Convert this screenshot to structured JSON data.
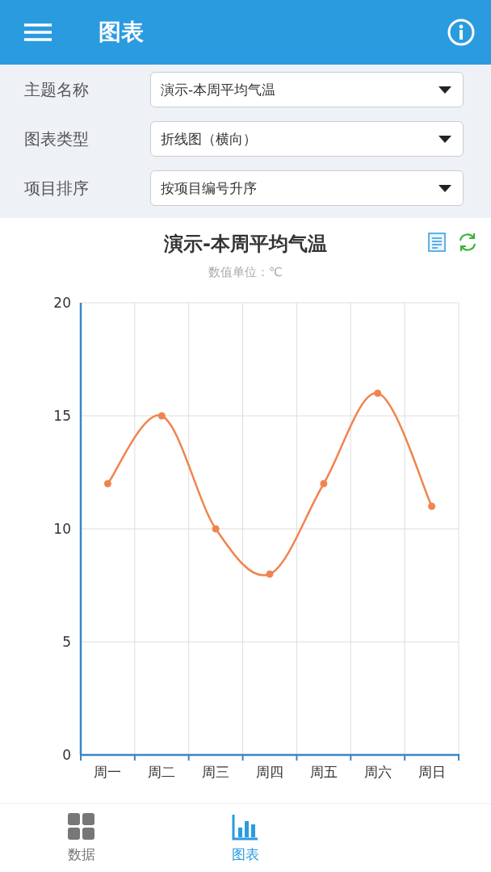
{
  "header": {
    "title": "图表"
  },
  "filters": [
    {
      "label": "主题名称",
      "value": "演示-本周平均气温"
    },
    {
      "label": "图表类型",
      "value": "折线图（横向）"
    },
    {
      "label": "项目排序",
      "value": "按项目编号升序"
    }
  ],
  "chart": {
    "title": "演示-本周平均气温",
    "subtitle": "数值单位：℃",
    "chart_data": {
      "type": "line",
      "categories": [
        "周一",
        "周二",
        "周三",
        "周四",
        "周五",
        "周六",
        "周日"
      ],
      "series": [
        {
          "color": "#f0844e",
          "marker": true,
          "values": [
            12,
            15,
            10,
            8,
            12,
            16,
            11
          ]
        }
      ],
      "grid": true,
      "ylim": [
        0,
        20
      ],
      "yticks": [
        0,
        5,
        10,
        15,
        20
      ]
    }
  },
  "bottom_nav": [
    {
      "label": "数据",
      "kind": "grid",
      "selected": false
    },
    {
      "label": "图表",
      "kind": "chart",
      "selected": true
    }
  ]
}
